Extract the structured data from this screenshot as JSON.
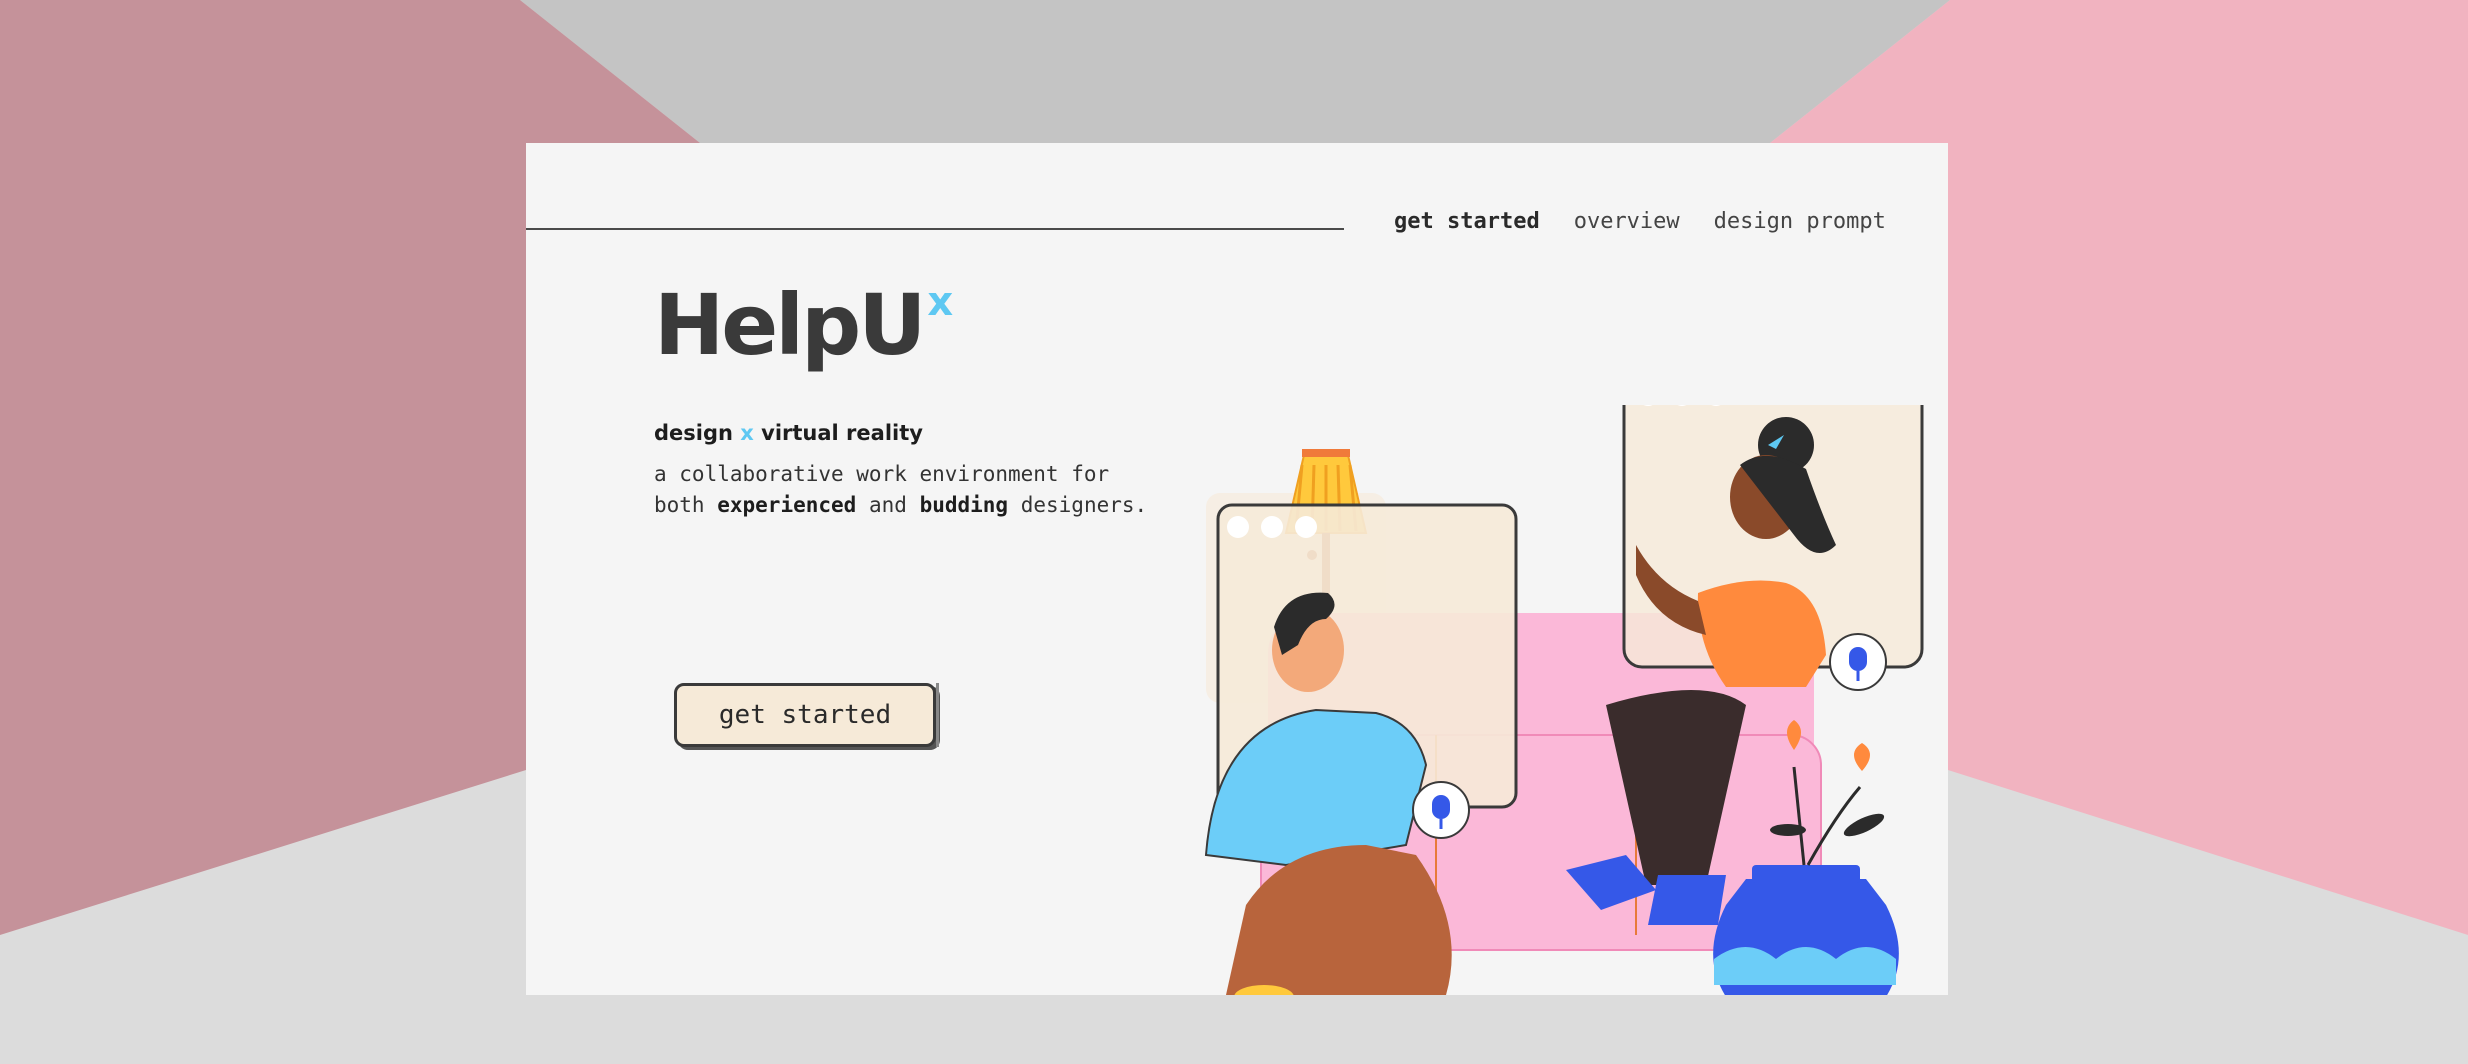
{
  "nav": {
    "items": [
      {
        "label": "get started",
        "active": true
      },
      {
        "label": "overview",
        "active": false
      },
      {
        "label": "design prompt",
        "active": false
      }
    ]
  },
  "logo": {
    "text": "HelpU",
    "superscript": "x"
  },
  "tagline": {
    "part1": "design",
    "x": "x",
    "part2": "virtual reality"
  },
  "description": {
    "line1": "a collaborative work environment for",
    "line2_pre": "both",
    "bold1": "experienced",
    "mid": "and",
    "bold2": "budding",
    "line2_post": "designers."
  },
  "cta": {
    "label": "get started"
  },
  "colors": {
    "accent": "#5ec8f2",
    "bg_left": "#c5929a",
    "bg_right": "#f1b3c0",
    "bg_top": "#c4c4c4",
    "bg_bottom": "#dcdcdc",
    "page": "#f5f5f5",
    "button_bg": "#f6ead8"
  },
  "illustration": {
    "icons": [
      "lamp-icon",
      "window-dots-icon",
      "microphone-icon",
      "sofa",
      "vase-icon",
      "flower-icon"
    ]
  }
}
